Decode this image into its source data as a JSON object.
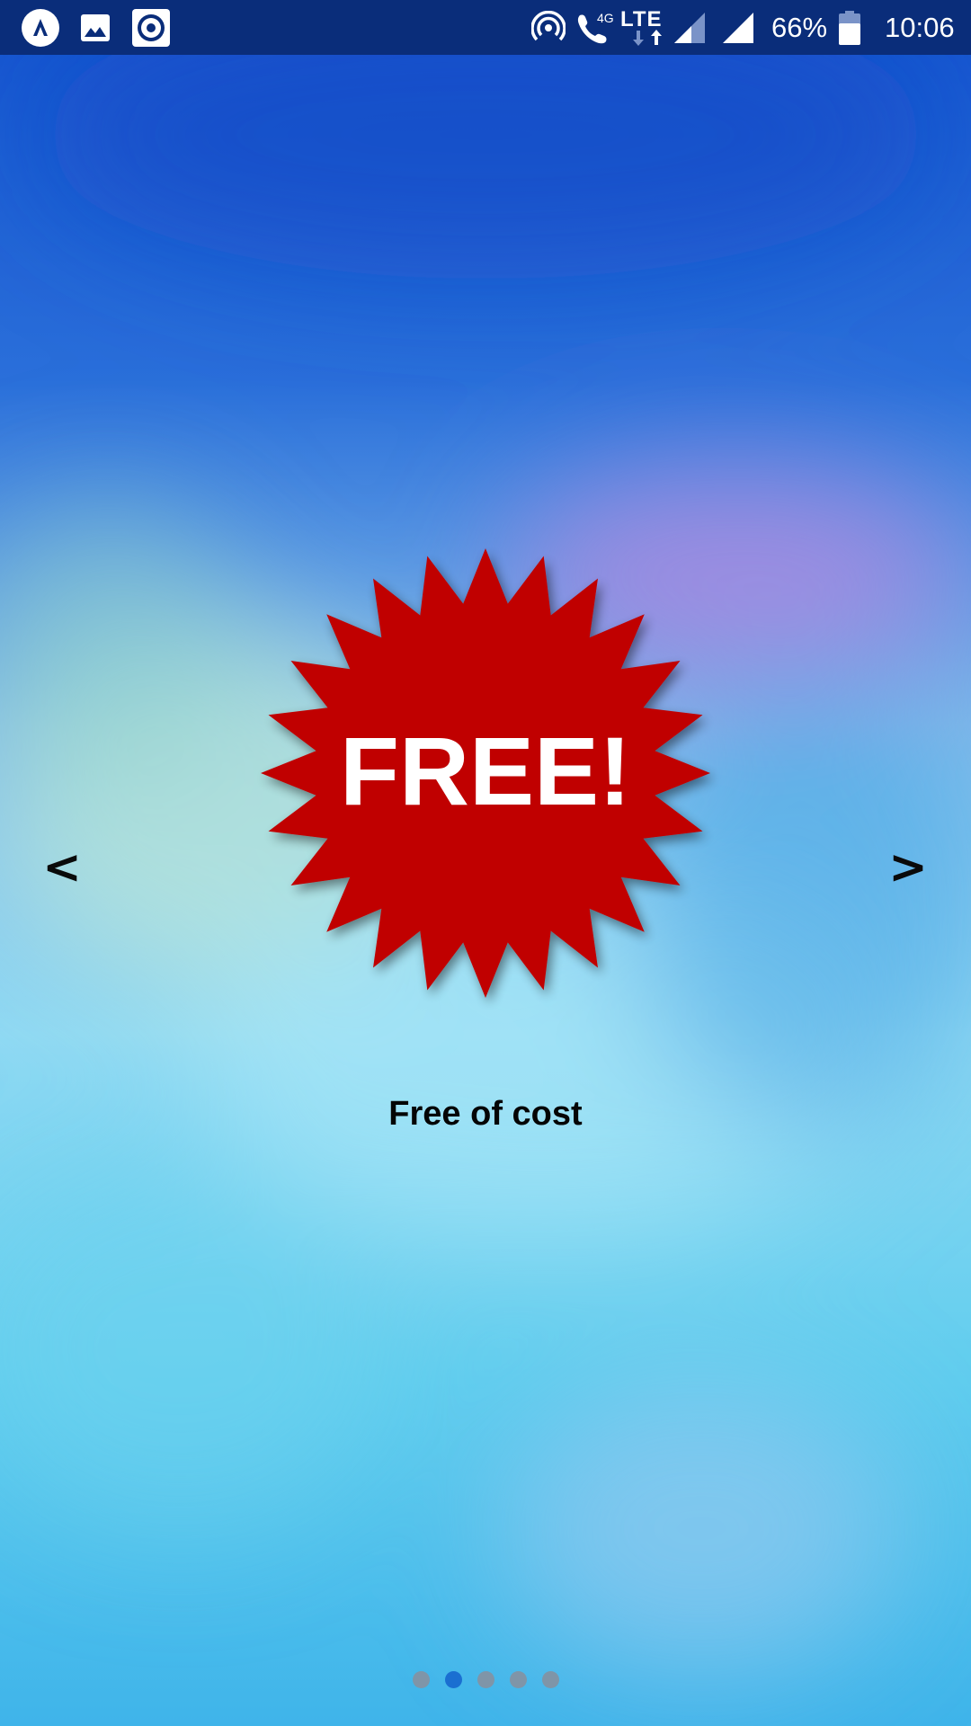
{
  "status_bar": {
    "battery_percent": "66%",
    "clock": "10:06",
    "network_type": "LTE",
    "call_network": "4G",
    "notification_icons": [
      "app-logo-icon",
      "image-icon",
      "record-icon"
    ],
    "system_icons": [
      "hotspot-icon",
      "wifi-calling-icon",
      "lte-data-icon",
      "signal-icon",
      "signal-full-icon",
      "battery-icon"
    ]
  },
  "carousel": {
    "prev_label": "<",
    "next_label": ">",
    "slide_badge_text": "FREE!",
    "slide_caption": "Free of cost",
    "total_pages": 5,
    "active_page": 2
  },
  "colors": {
    "status_bar": "#0a2d7a",
    "badge_red": "#c00000",
    "active_dot": "#1a6fd1",
    "inactive_dot": "#7f95a8"
  }
}
